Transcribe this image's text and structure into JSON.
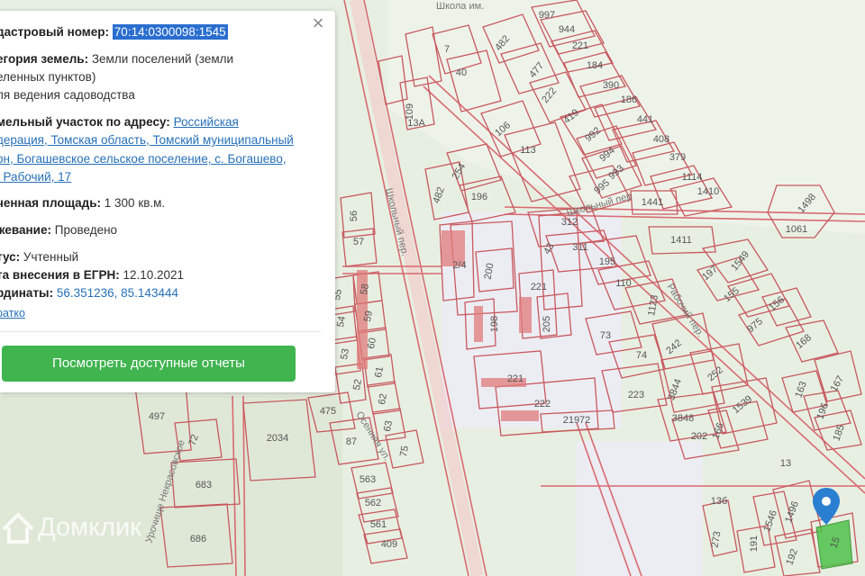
{
  "popup": {
    "close_glyph": "×",
    "cadastral_label": "дастровый номер:",
    "cadastral_number": "70:14:0300098:1545",
    "category_label": "егория земель:",
    "category_value": "Земли поселений (земли",
    "category_line2": "еленных пунктов)",
    "category_line3": "ля ведения садоводства",
    "address_label": "мельный участок по адресу:",
    "address_link_1": "Российская",
    "address_line_2": "дерация, Томская область, Томский муниципальный",
    "address_line_3": "он, Богашевское сельское поселение, с. Богашево,",
    "address_line_4": ", Рабочий, 17",
    "area_label": "ченная площадь:",
    "area_value": "1 300 кв.м.",
    "survey_label": "жевание:",
    "survey_value": "Проведено",
    "status_label": "тус:",
    "status_value": "Учтенный",
    "egrn_label": "та внесения в ЕГРН:",
    "egrn_value": "12.10.2021",
    "coords_label": "рдинаты:",
    "coords_value": "56.351236, 85.143444",
    "brief_link": "ратко",
    "reports_button": "Посмотреть доступные отчеты"
  },
  "map": {
    "watermark": "Домклик",
    "street_labels": [
      "Школьный пер.",
      "Рабочий пер.",
      "Школьный пер",
      "Осенняя ул.",
      "Урочище Некрасовское",
      "Школа им."
    ],
    "parcel_labels": [
      "997",
      "944",
      "221",
      "184",
      "390",
      "186",
      "441",
      "408",
      "379",
      "1114",
      "1410",
      "1441",
      "1498",
      "1061",
      "1411",
      "1549",
      "197",
      "155",
      "975",
      "156",
      "168",
      "167",
      "163",
      "196",
      "185",
      "7",
      "482",
      "477",
      "222",
      "419",
      "992",
      "994",
      "993",
      "995",
      "113",
      "106",
      "40",
      "109",
      "13А",
      "254",
      "482",
      "196",
      "56",
      "57",
      "312",
      "311",
      "195",
      "110",
      "1123",
      "73",
      "74",
      "242",
      "252",
      "3844",
      "3848",
      "1539",
      "202",
      "166",
      "223",
      "200",
      "221",
      "221",
      "222",
      "198",
      "205",
      "43",
      "2/4",
      "58",
      "59",
      "60",
      "61",
      "62",
      "63",
      "75",
      "55",
      "54",
      "53",
      "52",
      "497",
      "72",
      "475",
      "87",
      "2034",
      "563",
      "562",
      "561",
      "409",
      "683",
      "686",
      "21972",
      "273",
      "13",
      "13б",
      "191",
      "1546",
      "1496",
      "192",
      "15"
    ],
    "colors": {
      "parcel_stroke": "#c8585e",
      "road": "#d96a70",
      "background": "#e6eee0",
      "marker": "#2b7fd1",
      "selected_fill": "#4fc24a"
    }
  }
}
